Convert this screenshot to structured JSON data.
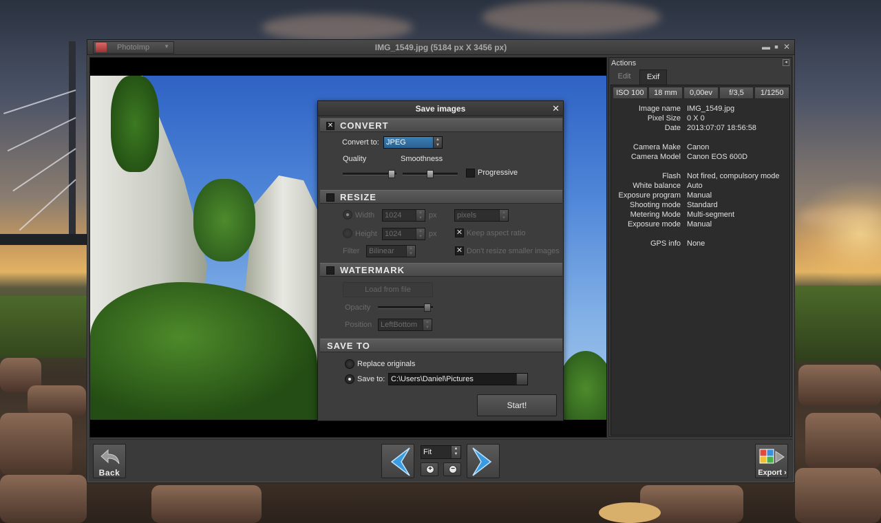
{
  "window": {
    "app_name": "PhotoImp",
    "title": "IMG_1549.jpg (5184 px X 3456 px)",
    "minimize": "▬",
    "maximize": "■",
    "close": "✕"
  },
  "actions_panel": {
    "title": "Actions",
    "collapse": "◂",
    "tabs": [
      {
        "label": "Edit",
        "active": false
      },
      {
        "label": "Exif",
        "active": true
      }
    ],
    "summary": [
      "ISO 100",
      "18 mm",
      "0,00ev",
      "f/3,5",
      "1/1250"
    ],
    "exif_rows": [
      {
        "label": "Image name",
        "value": "IMG_1549.jpg"
      },
      {
        "label": "Pixel Size",
        "value": "0 X 0"
      },
      {
        "label": "Date",
        "value": "2013:07:07 18:56:58"
      },
      {
        "label": "Camera Make",
        "value": "Canon"
      },
      {
        "label": "Camera Model",
        "value": "Canon EOS 600D"
      },
      {
        "label": "Flash",
        "value": "Not fired, compulsory mode"
      },
      {
        "label": "White balance",
        "value": "Auto"
      },
      {
        "label": "Exposure program",
        "value": "Manual"
      },
      {
        "label": "Shooting mode",
        "value": "Standard"
      },
      {
        "label": "Metering Mode",
        "value": "Multi-segment"
      },
      {
        "label": "Exposure mode",
        "value": "Manual"
      },
      {
        "label": "GPS info",
        "value": "None"
      }
    ]
  },
  "save_dialog": {
    "title": "Save images",
    "close": "✕",
    "convert": {
      "heading": "CONVERT",
      "enabled": true,
      "convert_to_label": "Convert to:",
      "format": "JPEG",
      "quality_label": "Quality",
      "quality_level": 0.92,
      "smoothness_label": "Smoothness",
      "smoothness_level": 0.5,
      "progressive_label": "Progressive",
      "progressive_checked": false
    },
    "resize": {
      "heading": "RESIZE",
      "enabled": false,
      "width_label": "Width",
      "width_value": "1024",
      "width_unit": "px",
      "height_label": "Height",
      "height_value": "1024",
      "height_unit": "px",
      "units": "pixels",
      "keep_aspect_label": "Keep aspect ratio",
      "keep_aspect_checked": true,
      "filter_label": "Filter",
      "filter_value": "Bilinear",
      "dont_resize_label": "Don't resize smaller images",
      "dont_resize_checked": true
    },
    "watermark": {
      "heading": "WATERMARK",
      "enabled": false,
      "load_button": "Load from file",
      "opacity_label": "Opacity",
      "opacity_level": 0.95,
      "position_label": "Position",
      "position_value": "LeftBottom"
    },
    "save_to": {
      "heading": "SAVE TO",
      "replace_label": "Replace originals",
      "replace_selected": false,
      "save_to_label": "Save to:",
      "save_to_selected": true,
      "path": "C:\\Users\\Daniel\\Pictures"
    },
    "start_button": "Start!"
  },
  "toolbar": {
    "back_label": "Back",
    "zoom_value": "Fit",
    "zoom_in": "+",
    "zoom_out": "−",
    "export_label": "Export"
  },
  "colors": {
    "accent": "#3b7fb5",
    "nav_arrow": "#3a9be0",
    "window_bg": "#3a3a3a"
  }
}
